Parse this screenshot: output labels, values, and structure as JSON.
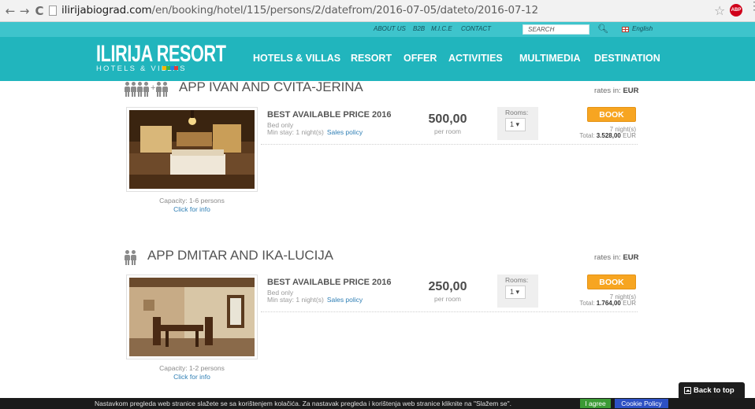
{
  "browser": {
    "back_glyph": "←",
    "forward_glyph": "→",
    "reload_glyph": "C",
    "url_host": "ilirijabiograd.com",
    "url_path": "/en/booking/hotel/115/persons/2/datefrom/2016-07-05/dateto/2016-07-12",
    "star_glyph": "☆",
    "abp_label": "ABP",
    "menu_glyph": "⋮"
  },
  "topbar": {
    "links": [
      "ABOUT US",
      "B2B",
      "M.I.C.E",
      "CONTACT"
    ],
    "search_placeholder": "SEARCH",
    "search_glyph": "🔍",
    "language": "English"
  },
  "header": {
    "logo_main": "ILIRIJA RESORT",
    "logo_sub": "HOTELS & VILLAS",
    "logo_colors": [
      "#f7b500",
      "#3ab54a",
      "#1e88e5",
      "#e53935"
    ],
    "nav": [
      "HOTELS & VILLAS",
      "RESORT",
      "OFFER",
      "ACTIVITIES",
      "MULTIMEDIA",
      "DESTINATION"
    ]
  },
  "colors": {
    "topbar": "#3ec4cc",
    "header": "#21b5bd",
    "book_button": "#f7a521",
    "link": "#2f7fb5"
  },
  "rooms": [
    {
      "plus_glyph": "+",
      "title": "APP IVAN AND CVITA-JERINA",
      "rates_prefix": "rates in:",
      "currency": "EUR",
      "capacity": "Capacity: 1-6 persons",
      "click_info": "Click for info",
      "offer_title": "BEST AVAILABLE PRICE 2016",
      "board": "Bed only",
      "min_stay": "Min stay: 1 night(s)",
      "sales_policy": "Sales policy",
      "price": "500,00",
      "per_room": "per room",
      "rooms_label": "Rooms:",
      "rooms_value": "1 ▾",
      "book_label": "BOOK",
      "nights": "7 night(s)",
      "total_prefix": "Total:",
      "total_value": "3.528,00",
      "total_currency": "EUR"
    },
    {
      "title": "APP DMITAR AND IKA-LUCIJA",
      "rates_prefix": "rates in:",
      "currency": "EUR",
      "capacity": "Capacity: 1-2 persons",
      "click_info": "Click for info",
      "offer_title": "BEST AVAILABLE PRICE 2016",
      "board": "Bed only",
      "min_stay": "Min stay: 1 night(s)",
      "sales_policy": "Sales policy",
      "price": "250,00",
      "per_room": "per room",
      "rooms_label": "Rooms:",
      "rooms_value": "1 ▾",
      "book_label": "BOOK",
      "nights": "7 night(s)",
      "total_prefix": "Total:",
      "total_value": "1.764,00",
      "total_currency": "EUR"
    }
  ],
  "cookie": {
    "text": "Nastavkom pregleda web stranice slažete se sa korištenjem kolačića. Za nastavak pregleda i korištenja web stranice kliknite na \"Slažem se\".",
    "agree": "I agree",
    "policy": "Cookie Policy"
  },
  "back_to_top": "Back to top"
}
